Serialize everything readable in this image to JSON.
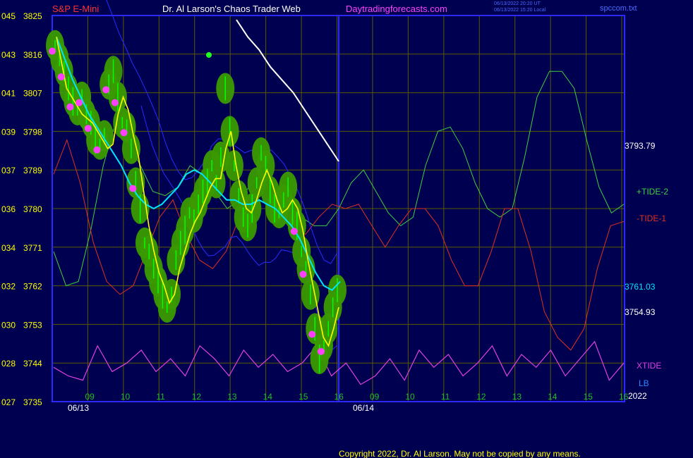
{
  "header": {
    "left_label": "S&P E-Mini",
    "center_title": "Dr. Al Larson's Chaos Trader Web",
    "site": "Daytradingforecasts.com",
    "timestamp_1": "06/13/2022 20:20 UT",
    "timestamp_2": "06/13/2022 15:20 Local",
    "file_label": "spccom.txt"
  },
  "footer": {
    "copyright": "Copyright 2022, Dr. Al Larson. May not be copied by any means."
  },
  "colors": {
    "background": "#000050",
    "frame": "#2a2aff",
    "grid": "#5a5a00",
    "price_bar": "#00ff00",
    "glow": "#3a9a00",
    "moving_avg_fast": "#ffff00",
    "moving_avg_slow": "#00e5ff",
    "channel": "#2a2aff",
    "tide_plus": "#40d040",
    "tide_minus": "#e03020",
    "xtide": "#e040e0",
    "dots": "#ff40ff",
    "white_line": "#ffffff"
  },
  "chart_data": {
    "type": "line",
    "title": "S&P E-Mini",
    "ylim": [
      3735,
      3825
    ],
    "y_ticks": [
      {
        "left": "045",
        "price": 3825
      },
      {
        "left": "043",
        "price": 3816
      },
      {
        "left": "041",
        "price": 3807
      },
      {
        "left": "039",
        "price": 3798
      },
      {
        "left": "037",
        "price": 3789
      },
      {
        "left": "036",
        "price": 3780
      },
      {
        "left": "034",
        "price": 3771
      },
      {
        "left": "032",
        "price": 3762
      },
      {
        "left": "030",
        "price": 3753
      },
      {
        "left": "028",
        "price": 3744
      },
      {
        "left": "027",
        "price": 3735
      }
    ],
    "x_ticks": [
      "09",
      "10",
      "11",
      "12",
      "13",
      "14",
      "15",
      "16",
      "09",
      "10",
      "11",
      "12",
      "13",
      "14",
      "15",
      "16"
    ],
    "date_labels": [
      "06/13",
      "06/14"
    ],
    "year_label": "2022",
    "right_values": [
      {
        "text": "3793.79",
        "price": 3793.79,
        "color": "#ffffff"
      },
      {
        "text": "3761.03",
        "price": 3761.03,
        "color": "#00e5ff"
      },
      {
        "text": "3754.93",
        "price": 3754.93,
        "color": "#ffffff"
      }
    ],
    "series_labels": [
      {
        "text": "+TIDE-2",
        "color": "#40d040"
      },
      {
        "text": "-TIDE-1",
        "color": "#e03020"
      },
      {
        "text": "XTIDE",
        "color": "#e040e0"
      },
      {
        "text": "LB",
        "color": "#2a8aff"
      }
    ],
    "price": [
      3818,
      3815,
      3812,
      3808,
      3805,
      3803,
      3806,
      3802,
      3800,
      3796,
      3795,
      3797,
      3809,
      3812,
      3806,
      3800,
      3799,
      3794,
      3786,
      3780,
      3772,
      3770,
      3766,
      3763,
      3760,
      3757,
      3760,
      3768,
      3772,
      3775,
      3779,
      3778,
      3781,
      3784,
      3786,
      3790,
      3786,
      3792,
      3808,
      3798,
      3790,
      3783,
      3778,
      3776,
      3780,
      3786,
      3793,
      3790,
      3784,
      3780,
      3779,
      3782,
      3785,
      3779,
      3776,
      3770,
      3766,
      3760,
      3752,
      3745,
      3748,
      3752,
      3757,
      3761
    ],
    "ma_fast": [
      3820,
      3814,
      3808,
      3806,
      3804,
      3802,
      3801,
      3800,
      3798,
      3796,
      3794,
      3795,
      3802,
      3806,
      3803,
      3797,
      3792,
      3784,
      3776,
      3770,
      3765,
      3762,
      3758,
      3760,
      3766,
      3770,
      3774,
      3777,
      3779,
      3782,
      3785,
      3787,
      3787,
      3794,
      3798,
      3790,
      3784,
      3780,
      3779,
      3782,
      3786,
      3789,
      3786,
      3782,
      3779,
      3780,
      3782,
      3780,
      3775,
      3768,
      3762,
      3756,
      3750,
      3748,
      3752,
      3757
    ],
    "ma_slow": [
      3820,
      3815,
      3810,
      3806,
      3802,
      3799,
      3796,
      3793,
      3790,
      3786,
      3783,
      3781,
      3780,
      3781,
      3783,
      3785,
      3788,
      3789,
      3788,
      3786,
      3784,
      3782,
      3782,
      3781,
      3781,
      3782,
      3781,
      3780,
      3778,
      3776,
      3773,
      3769,
      3765,
      3762,
      3761,
      3763
    ],
    "tide_plus": [
      3770,
      3762,
      3763,
      3775,
      3790,
      3800,
      3796,
      3790,
      3784,
      3783,
      3785,
      3790,
      3788,
      3784,
      3780,
      3782,
      3786,
      3788,
      3784,
      3780,
      3778,
      3776,
      3776,
      3780,
      3786,
      3789,
      3784,
      3779,
      3776,
      3778,
      3790,
      3798,
      3799,
      3794,
      3786,
      3780,
      3778,
      3780,
      3792,
      3806,
      3812,
      3812,
      3808,
      3796,
      3785,
      3779,
      3781
    ],
    "tide_minus": [
      3788,
      3796,
      3786,
      3772,
      3763,
      3760,
      3762,
      3770,
      3778,
      3782,
      3774,
      3768,
      3766,
      3770,
      3778,
      3784,
      3786,
      3780,
      3776,
      3774,
      3778,
      3781,
      3780,
      3781,
      3776,
      3771,
      3776,
      3780,
      3780,
      3776,
      3768,
      3762,
      3762,
      3770,
      3780,
      3780,
      3770,
      3756,
      3750,
      3747,
      3752,
      3766,
      3776,
      3777
    ],
    "xtide": [
      3743,
      3741,
      3740,
      3748,
      3742,
      3744,
      3747,
      3742,
      3745,
      3741,
      3748,
      3745,
      3741,
      3747,
      3743,
      3746,
      3742,
      3744,
      3748,
      3741,
      3744,
      3739,
      3741,
      3745,
      3740,
      3747,
      3743,
      3746,
      3741,
      3744,
      3748,
      3741,
      3746,
      3743,
      3747,
      3741,
      3745,
      3749,
      3740,
      3744
    ],
    "white_line": [
      3824,
      3820,
      3817,
      3813,
      3810,
      3807,
      3803,
      3799,
      3795,
      3791
    ]
  }
}
